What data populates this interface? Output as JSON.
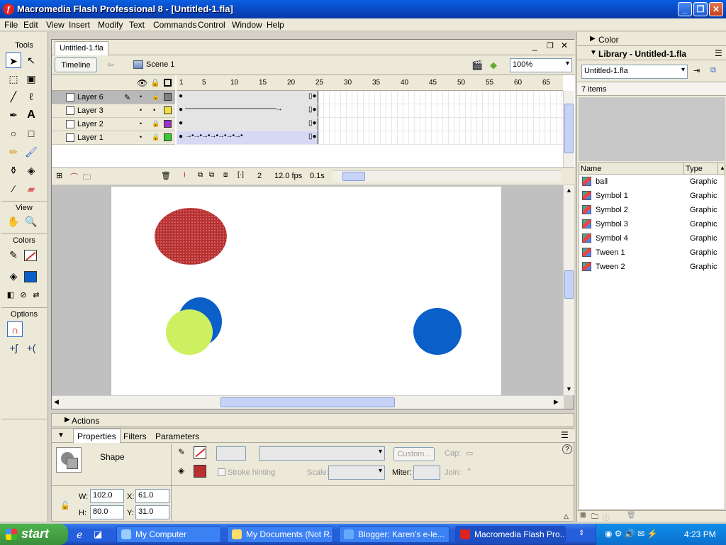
{
  "window": {
    "title": "Macromedia Flash Professional 8 - [Untitled-1.fla]",
    "app_icon": "flash-icon"
  },
  "menu": [
    "File",
    "Edit",
    "View",
    "Insert",
    "Modify",
    "Text",
    "Commands",
    "Control",
    "Window",
    "Help"
  ],
  "tools": {
    "label": "Tools",
    "view_label": "View",
    "colors_label": "Colors",
    "options_label": "Options",
    "items": [
      "arrow-icon",
      "subselect-icon",
      "free-transform-icon",
      "gradient-transform-icon",
      "line-icon",
      "lasso-icon",
      "pen-icon",
      "text-icon",
      "oval-icon",
      "rectangle-icon",
      "pencil-icon",
      "brush-icon",
      "ink-bottle-icon",
      "paint-bucket-icon",
      "eyedropper-icon",
      "eraser-icon"
    ],
    "stroke_color": "#cc3333",
    "fill_color": "#0a5fc8"
  },
  "document": {
    "tab": "Untitled-1.fla",
    "timeline_button": "Timeline",
    "scene": "Scene 1",
    "zoom": "100%"
  },
  "timeline": {
    "ruler": [
      "1",
      "5",
      "10",
      "15",
      "20",
      "25",
      "30",
      "35",
      "40",
      "45",
      "50",
      "55",
      "60",
      "65"
    ],
    "layers": [
      {
        "name": "Layer 6",
        "color": "#808080",
        "selected": true
      },
      {
        "name": "Layer 3",
        "color": "#f0e040",
        "selected": false
      },
      {
        "name": "Layer 2",
        "color": "#9933cc",
        "selected": false
      },
      {
        "name": "Layer 1",
        "color": "#33cc33",
        "selected": false
      }
    ],
    "current_frame": "2",
    "fps": "12.0 fps",
    "time": "0.1s"
  },
  "stage": {
    "shapes": [
      {
        "name": "red-oval",
        "color": "#b83030"
      },
      {
        "name": "blue-oval-back",
        "color": "#0a5fc8"
      },
      {
        "name": "green-oval",
        "color": "#ccf060"
      },
      {
        "name": "blue-oval-right",
        "color": "#0a5fc8"
      }
    ]
  },
  "panels": {
    "actions": "Actions",
    "tabs": [
      "Properties",
      "Filters",
      "Parameters"
    ],
    "shape_label": "Shape",
    "custom_button": "Custom...",
    "cap_label": "Cap:",
    "stroke_hinting": "Stroke hinting",
    "scale_label": "Scale:",
    "miter_label": "Miter:",
    "join_label": "Join:",
    "w_label": "W:",
    "w": "102.0",
    "h_label": "H:",
    "h": "80.0",
    "x_label": "X:",
    "x": "61.0",
    "y_label": "Y:",
    "y": "31.0"
  },
  "right": {
    "color_panel": "Color",
    "library_panel": "Library - Untitled-1.fla",
    "library_select": "Untitled-1.fla",
    "item_count": "7 items",
    "col_name": "Name",
    "col_type": "Type",
    "items": [
      {
        "name": "ball",
        "type": "Graphic"
      },
      {
        "name": "Symbol 1",
        "type": "Graphic"
      },
      {
        "name": "Symbol 2",
        "type": "Graphic"
      },
      {
        "name": "Symbol 3",
        "type": "Graphic"
      },
      {
        "name": "Symbol 4",
        "type": "Graphic"
      },
      {
        "name": "Tween 1",
        "type": "Graphic"
      },
      {
        "name": "Tween 2",
        "type": "Graphic"
      }
    ]
  },
  "taskbar": {
    "start": "start",
    "tasks": [
      {
        "label": "My Computer"
      },
      {
        "label": "My Documents (Not R..."
      },
      {
        "label": "Blogger: Karen's e-le..."
      },
      {
        "label": "Macromedia Flash Pro..."
      }
    ],
    "clock": "4:23 PM"
  }
}
